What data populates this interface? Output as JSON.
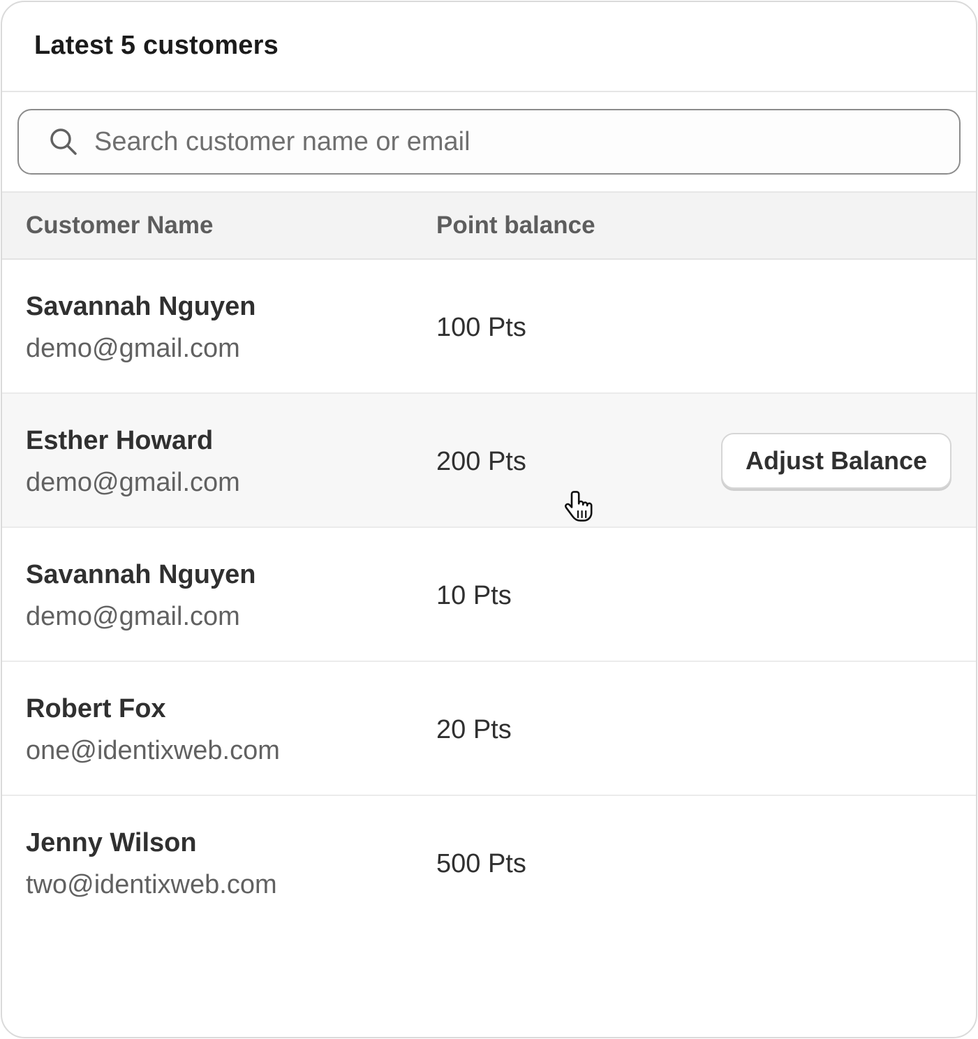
{
  "card": {
    "title": "Latest 5 customers"
  },
  "search": {
    "placeholder": "Search customer name or email",
    "value": ""
  },
  "table": {
    "headers": {
      "name": "Customer Name",
      "points": "Point balance"
    },
    "rows": [
      {
        "name": "Savannah Nguyen",
        "email": "demo@gmail.com",
        "points": "100 Pts"
      },
      {
        "name": "Esther Howard",
        "email": "demo@gmail.com",
        "points": "200 Pts",
        "action_label": "Adjust Balance"
      },
      {
        "name": "Savannah Nguyen",
        "email": "demo@gmail.com",
        "points": "10 Pts"
      },
      {
        "name": "Robert Fox",
        "email": "one@identixweb.com",
        "points": "20 Pts"
      },
      {
        "name": "Jenny Wilson",
        "email": "two@identixweb.com",
        "points": "500 Pts"
      }
    ]
  },
  "icons": {
    "search": "search-icon",
    "cursor": "pointer-hand-cursor"
  }
}
